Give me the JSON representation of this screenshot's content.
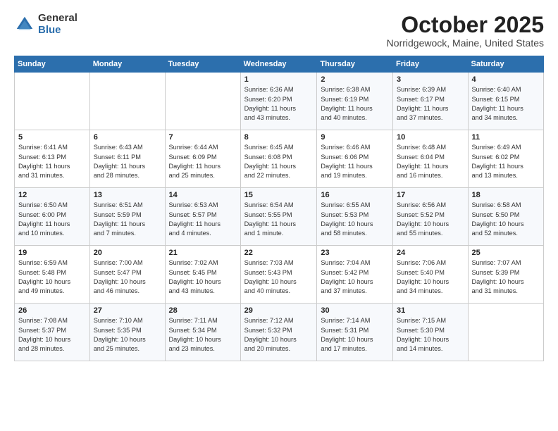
{
  "logo": {
    "general": "General",
    "blue": "Blue"
  },
  "title": "October 2025",
  "location": "Norridgewock, Maine, United States",
  "headers": [
    "Sunday",
    "Monday",
    "Tuesday",
    "Wednesday",
    "Thursday",
    "Friday",
    "Saturday"
  ],
  "weeks": [
    [
      {
        "day": "",
        "info": ""
      },
      {
        "day": "",
        "info": ""
      },
      {
        "day": "",
        "info": ""
      },
      {
        "day": "1",
        "info": "Sunrise: 6:36 AM\nSunset: 6:20 PM\nDaylight: 11 hours\nand 43 minutes."
      },
      {
        "day": "2",
        "info": "Sunrise: 6:38 AM\nSunset: 6:19 PM\nDaylight: 11 hours\nand 40 minutes."
      },
      {
        "day": "3",
        "info": "Sunrise: 6:39 AM\nSunset: 6:17 PM\nDaylight: 11 hours\nand 37 minutes."
      },
      {
        "day": "4",
        "info": "Sunrise: 6:40 AM\nSunset: 6:15 PM\nDaylight: 11 hours\nand 34 minutes."
      }
    ],
    [
      {
        "day": "5",
        "info": "Sunrise: 6:41 AM\nSunset: 6:13 PM\nDaylight: 11 hours\nand 31 minutes."
      },
      {
        "day": "6",
        "info": "Sunrise: 6:43 AM\nSunset: 6:11 PM\nDaylight: 11 hours\nand 28 minutes."
      },
      {
        "day": "7",
        "info": "Sunrise: 6:44 AM\nSunset: 6:09 PM\nDaylight: 11 hours\nand 25 minutes."
      },
      {
        "day": "8",
        "info": "Sunrise: 6:45 AM\nSunset: 6:08 PM\nDaylight: 11 hours\nand 22 minutes."
      },
      {
        "day": "9",
        "info": "Sunrise: 6:46 AM\nSunset: 6:06 PM\nDaylight: 11 hours\nand 19 minutes."
      },
      {
        "day": "10",
        "info": "Sunrise: 6:48 AM\nSunset: 6:04 PM\nDaylight: 11 hours\nand 16 minutes."
      },
      {
        "day": "11",
        "info": "Sunrise: 6:49 AM\nSunset: 6:02 PM\nDaylight: 11 hours\nand 13 minutes."
      }
    ],
    [
      {
        "day": "12",
        "info": "Sunrise: 6:50 AM\nSunset: 6:00 PM\nDaylight: 11 hours\nand 10 minutes."
      },
      {
        "day": "13",
        "info": "Sunrise: 6:51 AM\nSunset: 5:59 PM\nDaylight: 11 hours\nand 7 minutes."
      },
      {
        "day": "14",
        "info": "Sunrise: 6:53 AM\nSunset: 5:57 PM\nDaylight: 11 hours\nand 4 minutes."
      },
      {
        "day": "15",
        "info": "Sunrise: 6:54 AM\nSunset: 5:55 PM\nDaylight: 11 hours\nand 1 minute."
      },
      {
        "day": "16",
        "info": "Sunrise: 6:55 AM\nSunset: 5:53 PM\nDaylight: 10 hours\nand 58 minutes."
      },
      {
        "day": "17",
        "info": "Sunrise: 6:56 AM\nSunset: 5:52 PM\nDaylight: 10 hours\nand 55 minutes."
      },
      {
        "day": "18",
        "info": "Sunrise: 6:58 AM\nSunset: 5:50 PM\nDaylight: 10 hours\nand 52 minutes."
      }
    ],
    [
      {
        "day": "19",
        "info": "Sunrise: 6:59 AM\nSunset: 5:48 PM\nDaylight: 10 hours\nand 49 minutes."
      },
      {
        "day": "20",
        "info": "Sunrise: 7:00 AM\nSunset: 5:47 PM\nDaylight: 10 hours\nand 46 minutes."
      },
      {
        "day": "21",
        "info": "Sunrise: 7:02 AM\nSunset: 5:45 PM\nDaylight: 10 hours\nand 43 minutes."
      },
      {
        "day": "22",
        "info": "Sunrise: 7:03 AM\nSunset: 5:43 PM\nDaylight: 10 hours\nand 40 minutes."
      },
      {
        "day": "23",
        "info": "Sunrise: 7:04 AM\nSunset: 5:42 PM\nDaylight: 10 hours\nand 37 minutes."
      },
      {
        "day": "24",
        "info": "Sunrise: 7:06 AM\nSunset: 5:40 PM\nDaylight: 10 hours\nand 34 minutes."
      },
      {
        "day": "25",
        "info": "Sunrise: 7:07 AM\nSunset: 5:39 PM\nDaylight: 10 hours\nand 31 minutes."
      }
    ],
    [
      {
        "day": "26",
        "info": "Sunrise: 7:08 AM\nSunset: 5:37 PM\nDaylight: 10 hours\nand 28 minutes."
      },
      {
        "day": "27",
        "info": "Sunrise: 7:10 AM\nSunset: 5:35 PM\nDaylight: 10 hours\nand 25 minutes."
      },
      {
        "day": "28",
        "info": "Sunrise: 7:11 AM\nSunset: 5:34 PM\nDaylight: 10 hours\nand 23 minutes."
      },
      {
        "day": "29",
        "info": "Sunrise: 7:12 AM\nSunset: 5:32 PM\nDaylight: 10 hours\nand 20 minutes."
      },
      {
        "day": "30",
        "info": "Sunrise: 7:14 AM\nSunset: 5:31 PM\nDaylight: 10 hours\nand 17 minutes."
      },
      {
        "day": "31",
        "info": "Sunrise: 7:15 AM\nSunset: 5:30 PM\nDaylight: 10 hours\nand 14 minutes."
      },
      {
        "day": "",
        "info": ""
      }
    ]
  ]
}
